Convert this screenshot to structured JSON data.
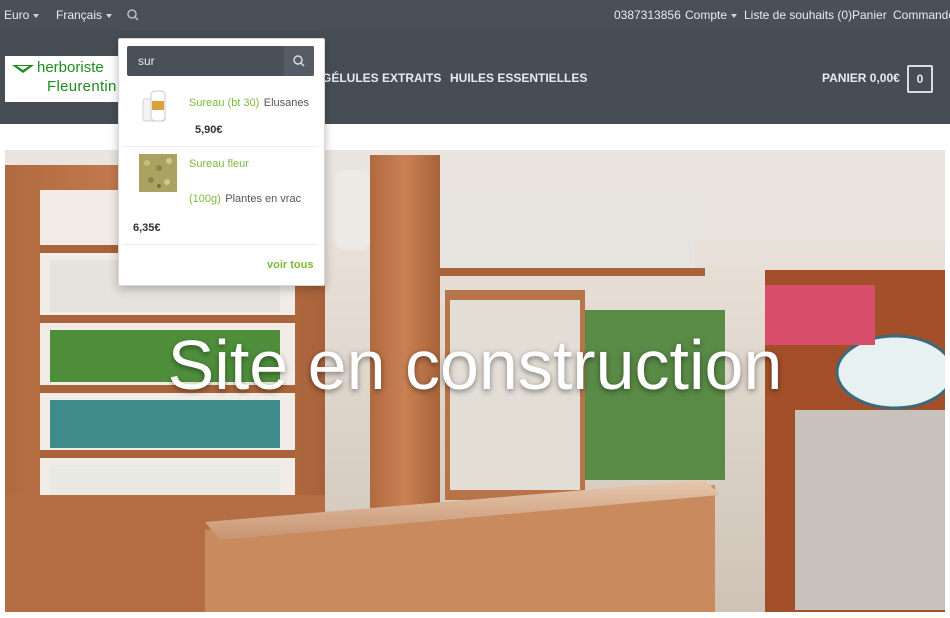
{
  "topbar": {
    "currency": "Euro",
    "language": "Français",
    "phone": "0387313856",
    "account": "Compte",
    "wishlist": "Liste de souhaits (0)",
    "cart": "Panier",
    "orders": "Commander"
  },
  "logo": {
    "line1": "herboriste",
    "line2": "Fleurentin"
  },
  "nav": {
    "items": [
      {
        "label": "GÉLULES"
      },
      {
        "label": "EXTRAITS"
      },
      {
        "label": "HUILES ESSENTIELLES"
      }
    ]
  },
  "header_cart": {
    "label": "PANIER 0,00€",
    "count": "0"
  },
  "search": {
    "value": "sur",
    "results": [
      {
        "name": "Sureau (bt 30)",
        "category": "Elusanes",
        "price": "5,90€"
      },
      {
        "name_line1": "Sureau fleur",
        "name_line2": "(100g)",
        "category": "Plantes en vrac",
        "price": "6,35€"
      }
    ],
    "view_all": "voir tous"
  },
  "hero": {
    "title": "Site en construction"
  },
  "colors": {
    "topbar": "#4a5058",
    "header": "#474d55",
    "accent_green": "#7cbb3a",
    "logo_green": "#1c8d1c"
  },
  "icons": [
    "chevron-down-icon",
    "search-icon",
    "leaf-logo-icon"
  ]
}
